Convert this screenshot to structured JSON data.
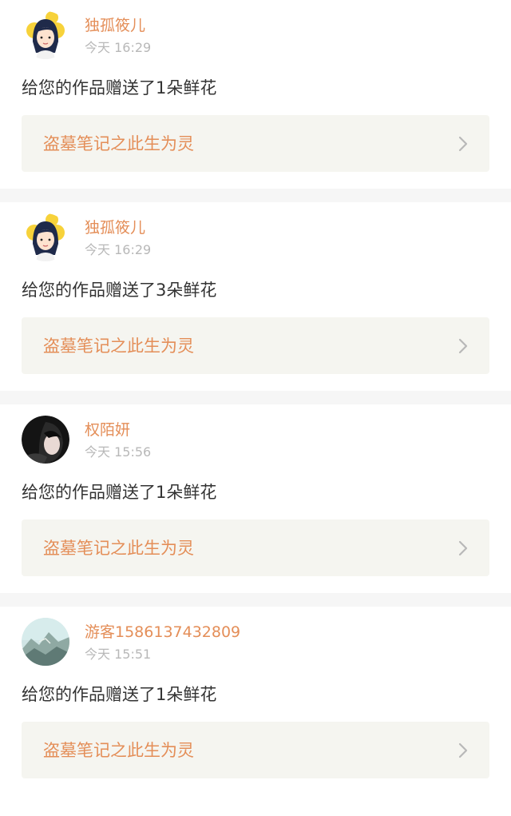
{
  "notifications": [
    {
      "user": "独孤筱儿",
      "time": "今天 16:29",
      "message": "给您的作品赠送了1朵鲜花",
      "work_title": "盗墓笔记之此生为灵",
      "avatar_icon": "cartoon-girl-avatar"
    },
    {
      "user": "独孤筱儿",
      "time": "今天 16:29",
      "message": "给您的作品赠送了3朵鲜花",
      "work_title": "盗墓笔记之此生为灵",
      "avatar_icon": "cartoon-girl-avatar"
    },
    {
      "user": "权陌妍",
      "time": "今天 15:56",
      "message": "给您的作品赠送了1朵鲜花",
      "work_title": "盗墓笔记之此生为灵",
      "avatar_icon": "photo-avatar-dark"
    },
    {
      "user": "游客1586137432809",
      "time": "今天 15:51",
      "message": "给您的作品赠送了1朵鲜花",
      "work_title": "盗墓笔记之此生为灵",
      "avatar_icon": "landscape-avatar"
    }
  ],
  "colors": {
    "accent": "#e48e58",
    "text": "#333333",
    "muted": "#b8b8b8",
    "work_bg": "#f5f5f0",
    "separator": "#f6f6f6"
  }
}
